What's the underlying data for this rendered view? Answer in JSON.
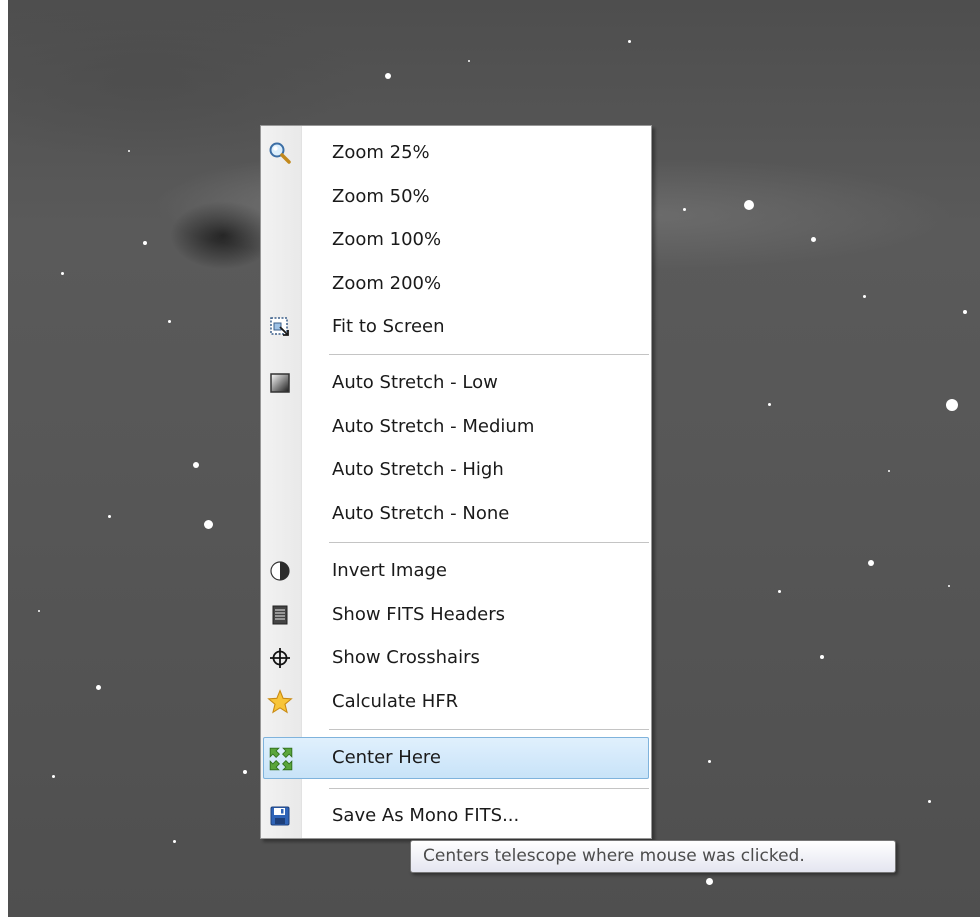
{
  "menu": {
    "items": [
      {
        "label": "Zoom 25%",
        "icon": "magnifier-icon"
      },
      {
        "label": "Zoom 50%",
        "icon": ""
      },
      {
        "label": "Zoom 100%",
        "icon": ""
      },
      {
        "label": "Zoom 200%",
        "icon": ""
      },
      {
        "label": "Fit to Screen",
        "icon": "fit-to-screen-icon"
      },
      {
        "label": "Auto Stretch - Low",
        "icon": "gradient-icon"
      },
      {
        "label": "Auto Stretch - Medium",
        "icon": ""
      },
      {
        "label": "Auto Stretch - High",
        "icon": ""
      },
      {
        "label": "Auto Stretch - None",
        "icon": ""
      },
      {
        "label": "Invert Image",
        "icon": "half-circle-icon"
      },
      {
        "label": "Show FITS Headers",
        "icon": "document-icon"
      },
      {
        "label": "Show Crosshairs",
        "icon": "crosshair-icon"
      },
      {
        "label": "Calculate HFR",
        "icon": "star-icon"
      },
      {
        "label": "Center Here",
        "icon": "center-arrows-icon",
        "highlighted": true
      },
      {
        "label": "Save As Mono FITS...",
        "icon": "floppy-disk-icon"
      }
    ]
  },
  "tooltip": {
    "text": "Centers telescope where mouse was clicked."
  },
  "colors": {
    "highlight": "#c8e3f8",
    "highlight_border": "#7fb3dc",
    "star_icon": "#f5b51e",
    "center_icon": "#5aa53c",
    "floppy_icon": "#2f64b8"
  }
}
